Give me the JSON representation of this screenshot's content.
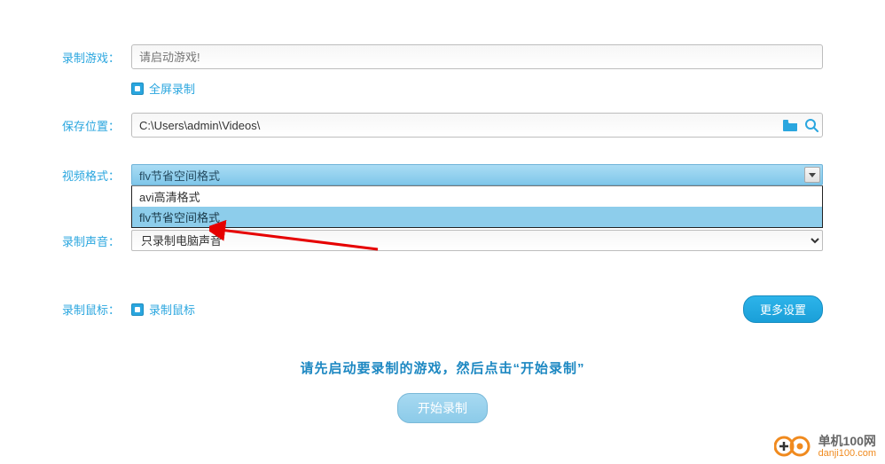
{
  "labels": {
    "record_game": "录制游戏：",
    "save_location": "保存位置：",
    "video_format": "视频格式：",
    "record_audio": "录制声音：",
    "record_mouse": "录制鼠标："
  },
  "game_input": {
    "placeholder": "请启动游戏!"
  },
  "fullscreen": {
    "label": "全屏录制"
  },
  "save_path": {
    "value": "C:\\Users\\admin\\Videos\\"
  },
  "video_format_select": {
    "selected": "flv节省空间格式",
    "options": [
      "avi高清格式",
      "flv节省空间格式"
    ]
  },
  "audio_select": {
    "selected": "只录制电脑声音"
  },
  "mouse": {
    "label": "录制鼠标"
  },
  "more_settings": "更多设置",
  "prompt_text": "请先启动要录制的游戏，然后点击“开始录制”",
  "start_button": "开始录制",
  "watermark": {
    "title": "单机100网",
    "url": "danji100.com"
  }
}
